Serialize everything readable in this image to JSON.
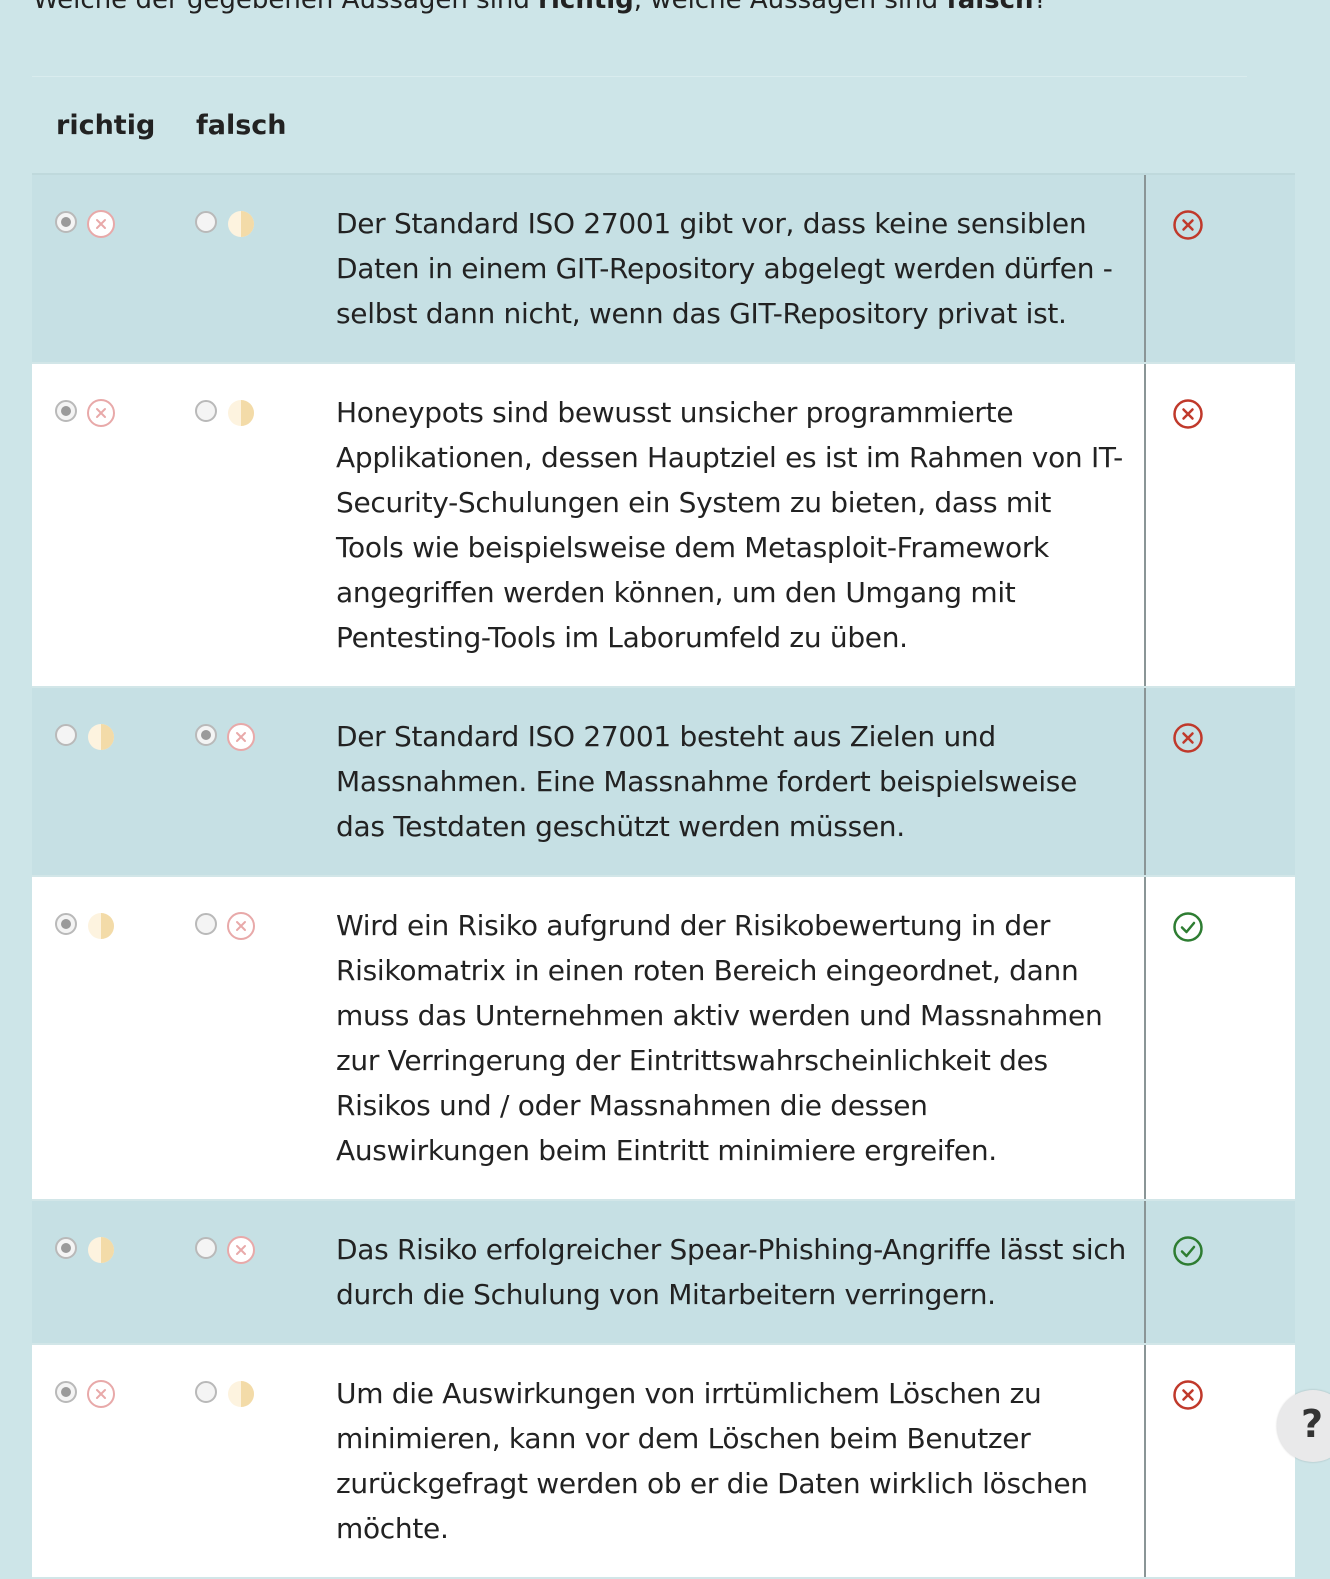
{
  "question": {
    "prefix": "Welche der gegebenen Aussagen sind ",
    "bold1": "richtig",
    "middle": ", welche Aussagen sind ",
    "bold2": "falsch",
    "suffix": "?"
  },
  "columns": {
    "correct": "richtig",
    "wrong": "falsch"
  },
  "rows": [
    {
      "text": "Der Standard ISO 27001 gibt vor, dass keine sensiblen Daten in einem GIT-Repository abgelegt werden dürfen - selbst dann nicht, wenn das GIT-Repository privat ist.",
      "shaded": true,
      "richtig": {
        "selected": true,
        "mark": "x"
      },
      "falsch": {
        "selected": false,
        "mark": "half"
      },
      "result": "wrong"
    },
    {
      "text": "Honeypots sind bewusst unsicher programmierte Applikationen, dessen Hauptziel es ist im Rahmen von IT-Security-Schulungen ein System zu bieten, dass mit Tools wie beispielsweise dem Metasploit-Framework angegriffen werden können, um den Umgang mit Pentesting-Tools im Laborumfeld zu üben.",
      "shaded": false,
      "richtig": {
        "selected": true,
        "mark": "x"
      },
      "falsch": {
        "selected": false,
        "mark": "half"
      },
      "result": "wrong"
    },
    {
      "text": "Der Standard ISO 27001 besteht aus Zielen und Massnahmen. Eine Massnahme fordert beispielsweise das Testdaten geschützt werden müssen.",
      "shaded": true,
      "richtig": {
        "selected": false,
        "mark": "half"
      },
      "falsch": {
        "selected": true,
        "mark": "x"
      },
      "result": "wrong"
    },
    {
      "text": "Wird ein Risiko aufgrund der Risikobewertung in der Risikomatrix in einen roten Bereich eingeordnet, dann muss das Unternehmen aktiv werden und Massnahmen zur Verringerung der Eintrittswahrscheinlichkeit des Risikos und / oder Massnahmen die dessen Auswirkungen beim Eintritt minimiere ergreifen.",
      "shaded": false,
      "richtig": {
        "selected": true,
        "mark": "half"
      },
      "falsch": {
        "selected": false,
        "mark": "x"
      },
      "result": "correct"
    },
    {
      "text": "Das Risiko erfolgreicher Spear-Phishing-Angriffe lässt sich durch die Schulung von Mitarbeitern verringern.",
      "shaded": true,
      "richtig": {
        "selected": true,
        "mark": "half"
      },
      "falsch": {
        "selected": false,
        "mark": "x"
      },
      "result": "correct"
    },
    {
      "text": "Um die Auswirkungen von irrtümlichem Löschen zu minimieren, kann vor dem Löschen beim Benutzer zurückgefragt werden ob er die Daten wirklich löschen möchte.",
      "shaded": false,
      "richtig": {
        "selected": true,
        "mark": "x"
      },
      "falsch": {
        "selected": false,
        "mark": "half"
      },
      "result": "wrong"
    }
  ],
  "help": {
    "label": "?"
  },
  "colors": {
    "background": "#cde5e8",
    "row_shaded": "#c6e0e4",
    "row_plain": "#ffffff",
    "wrong": "#c0392b",
    "correct": "#2e7d32",
    "x_mark": "#e8a9a9",
    "half_mark": "#f3dba8"
  },
  "icons": {
    "wrong": "circle-x-icon",
    "correct": "circle-check-icon",
    "x_mark": "x-circle-icon",
    "half_mark": "half-circle-icon"
  }
}
